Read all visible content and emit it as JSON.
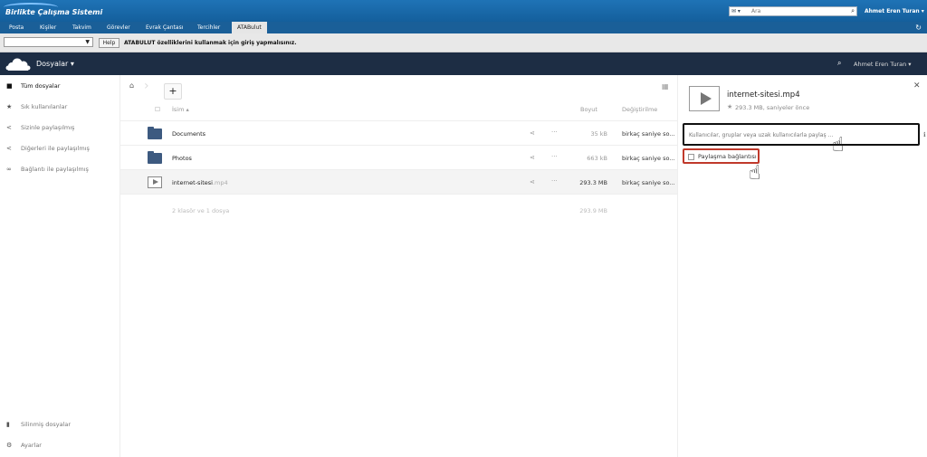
{
  "topbar": {
    "logo": "Birlikte Çalışma Sistemi",
    "search_placeholder": "Ara",
    "mail_select": "▾",
    "user": "Ahmet Eren Turan"
  },
  "tabs": [
    {
      "label": "Posta"
    },
    {
      "label": "Kişiler"
    },
    {
      "label": "Takvim"
    },
    {
      "label": "Görevler"
    },
    {
      "label": "Evrak Çantası"
    },
    {
      "label": "Tercihler"
    },
    {
      "label": "ATABulut"
    }
  ],
  "subbar": {
    "help_label": "Help",
    "notice": "ATABULUT özelliklerini kullanmak için giriş yapmalısınız."
  },
  "header": {
    "app_title": "Dosyalar",
    "user": "Ahmet Eren Turan"
  },
  "sidebar": {
    "items": [
      {
        "label": "Tüm dosyalar",
        "icon": "folder-icon"
      },
      {
        "label": "Sık kullanılanlar",
        "icon": "star-icon"
      },
      {
        "label": "Sizinle paylaşılmış",
        "icon": "share-icon"
      },
      {
        "label": "Diğerleri ile paylaşılmış",
        "icon": "share-icon"
      },
      {
        "label": "Bağlantı ile paylaşılmış",
        "icon": "link-icon"
      }
    ],
    "bottom": [
      {
        "label": "Silinmiş dosyalar",
        "icon": "trash-icon"
      },
      {
        "label": "Ayarlar",
        "icon": "gear-icon"
      }
    ]
  },
  "table": {
    "col_name": "İsim",
    "col_size": "Boyut",
    "col_modified": "Değiştirilme",
    "rows": [
      {
        "name": "Documents",
        "ext": "",
        "size": "35 kB",
        "modified": "birkaç saniye so..."
      },
      {
        "name": "Photos",
        "ext": "",
        "size": "663 kB",
        "modified": "birkaç saniye so..."
      },
      {
        "name": "internet-sitesi",
        "ext": ".mp4",
        "size": "293.3 MB",
        "modified": "birkaç saniye so..."
      }
    ],
    "summary": "2 klasör ve 1 dosya",
    "summary_size": "293.9 MB"
  },
  "details": {
    "filename": "internet-sitesi.mp4",
    "meta": "293.3 MB, saniyeler önce",
    "share_placeholder": "Kullanıcılar, gruplar veya uzak kullanıcılarla paylaş ...",
    "link_label": "Paylaşma bağlantısı"
  },
  "colors": {
    "topbar": "#1a6aa8",
    "header": "#1d2d44",
    "folder": "#3d5a80",
    "highlight": "#c0392b"
  }
}
